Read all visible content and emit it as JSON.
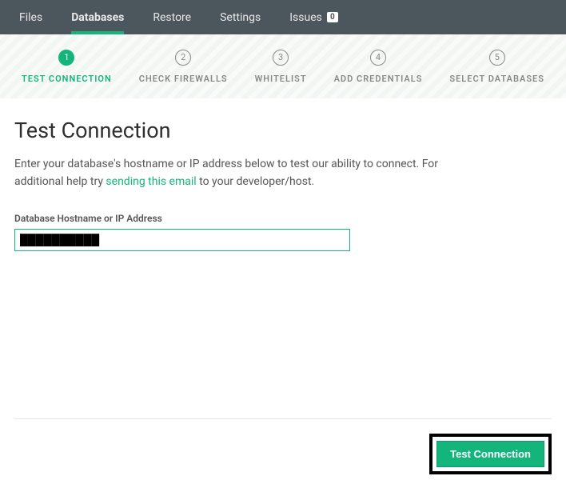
{
  "nav": {
    "files": "Files",
    "databases": "Databases",
    "restore": "Restore",
    "settings": "Settings",
    "issues": "Issues",
    "issues_count": "0"
  },
  "steps": {
    "s1": {
      "num": "1",
      "label": "TEST CONNECTION"
    },
    "s2": {
      "num": "2",
      "label": "CHECK FIREWALLS"
    },
    "s3": {
      "num": "3",
      "label": "WHITELIST"
    },
    "s4": {
      "num": "4",
      "label": "ADD CREDENTIALS"
    },
    "s5": {
      "num": "5",
      "label": "SELECT DATABASES"
    }
  },
  "page": {
    "title": "Test Connection",
    "desc_before": "Enter your database's hostname or IP address below to test our ability to connect. For additional help try ",
    "desc_link": "sending this email",
    "desc_after": " to your developer/host.",
    "field_label": "Database Hostname or IP Address",
    "input_value": "██████████",
    "submit_label": "Test Connection"
  }
}
